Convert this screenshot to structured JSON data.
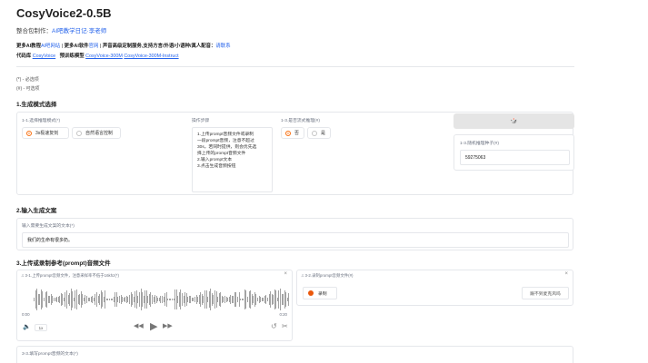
{
  "header": {
    "title": "CosyVoice2-0.5B",
    "subtitle_prefix": "整合包制作：",
    "subtitle_link": "AI吧教学日记·李老师",
    "line1_a": "更多AI教程",
    "line1_a_link": "AI吧网站",
    "line1_sep1": "|",
    "line1_b": "更多AI软件",
    "line1_b_link": "官网",
    "line1_sep2": "|",
    "line1_c": "声音高级定制服务,支持方言/外语/小语种/真人配音：",
    "line1_c_link": "请联系",
    "line2_a": "代码库",
    "line2_a_link": "CosyVoice",
    "line2_b": "预训练模型",
    "line2_b_link1": "CosyVoice-300M",
    "line2_b_link2": "CosyVoice-300M-Instruct"
  },
  "legend": {
    "required": "(*) - 必选项",
    "optional": "(#) - 可选项"
  },
  "section1": {
    "heading": "1.生成模式选择",
    "mode_label": "1-1.选择推理模式(*)",
    "mode_options": [
      "3s极速复刻",
      "自然语言控制"
    ],
    "mode_selected": 0,
    "steps_label": "操作步骤",
    "steps": [
      "1.上传prompt音频文件或录制",
      "一段prompt音频，注意不超过",
      "30s，若同时提供，则会优先选",
      "择上传的prompt音频文件",
      "2.输入prompt文本",
      "3.点击生成音频按钮"
    ],
    "stream_label": "1-3.是否流式推理(#)",
    "stream_options": [
      "否",
      "是"
    ],
    "stream_selected": 0,
    "dice_button": "🎲",
    "seed_label": "1-3.随机推理种子(#)",
    "seed_value": "59275063"
  },
  "section2": {
    "heading": "2.输入生成文案",
    "text_label": "输入需要生成文案的文本(*)",
    "text_value": "我们的生命有很多奶。"
  },
  "section3": {
    "heading": "3.上传或录制参考(prompt)音频文件",
    "upload_label": "3-1.上传prompt音频文件，注意采样率不低于16khz(*)",
    "time_start": "0:00",
    "time_end": "0:20",
    "speed": "1x",
    "record_label": "3-2.录制prompt音频文件(#)",
    "record_button": "录制",
    "source_button": "跟不到麦克风吗",
    "next_label": "3-3.填写prompt音频的文本(*)"
  },
  "colors": {
    "accent": "#f97316",
    "link": "#2563eb"
  }
}
